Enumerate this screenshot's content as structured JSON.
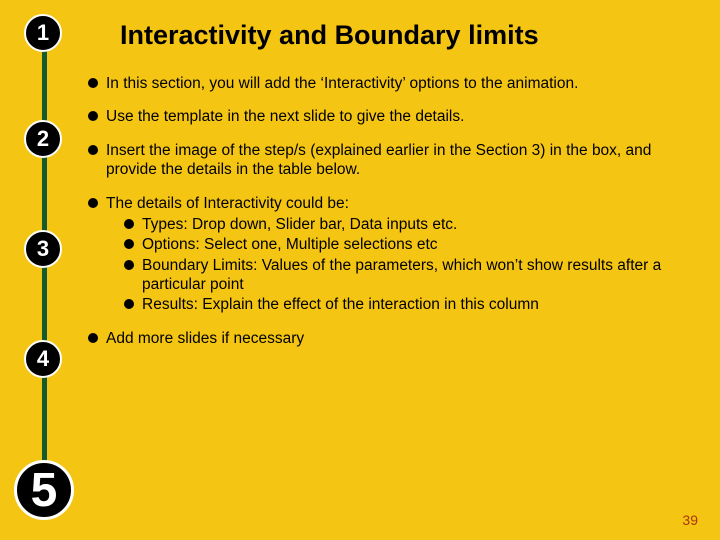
{
  "title": "Interactivity and Boundary limits",
  "stepper": {
    "steps": [
      "1",
      "2",
      "3",
      "4",
      "5"
    ],
    "current_index": 4
  },
  "bullets": [
    {
      "text": "In this section, you will add the ‘Interactivity’ options to the animation."
    },
    {
      "text": "Use the template in the next slide to give the details."
    },
    {
      "text": "Insert the image of the step/s (explained earlier in the Section 3) in the box, and provide the details in the table below."
    },
    {
      "text": "The details of Interactivity could be:",
      "subs": [
        "Types: Drop down, Slider bar, Data inputs etc.",
        "Options: Select one, Multiple selections etc",
        "Boundary Limits: Values of the parameters, which won’t show results after a particular point",
        "Results: Explain the effect of the interaction in this column"
      ]
    },
    {
      "text": "Add more slides if necessary"
    }
  ],
  "page_number": "39"
}
